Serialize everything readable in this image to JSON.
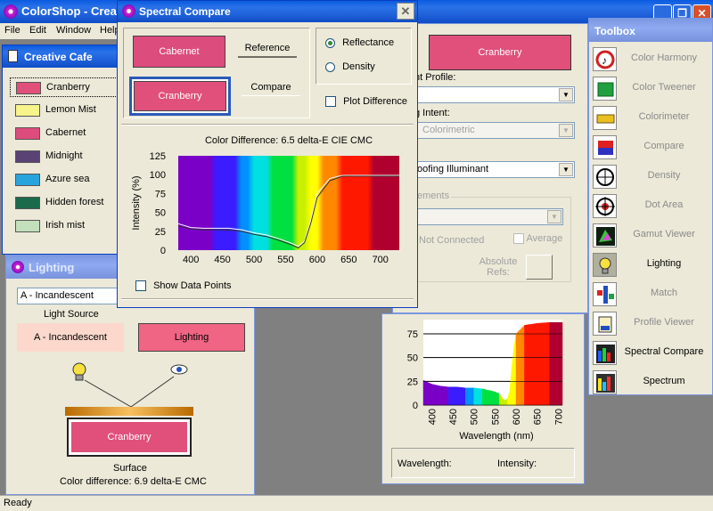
{
  "app": {
    "title": "ColorShop - Creat",
    "status": "Ready"
  },
  "menu": [
    "File",
    "Edit",
    "Window",
    "Help"
  ],
  "creative_cafe": {
    "title": "Creative Cafe",
    "swatches": [
      {
        "name": "Cranberry",
        "color": "#e0507a"
      },
      {
        "name": "Lemon Mist",
        "color": "#f6f48a"
      },
      {
        "name": "Cabernet",
        "color": "#dc4c7c"
      },
      {
        "name": "Midnight",
        "color": "#5a4274"
      },
      {
        "name": "Azure sea",
        "color": "#27a4dc"
      },
      {
        "name": "Hidden forest",
        "color": "#1c6a4c"
      },
      {
        "name": "Irish mist",
        "color": "#c2e0bc"
      }
    ]
  },
  "lighting": {
    "title": "Lighting",
    "source_select": "A - Incandescent",
    "light_source_label": "Light Source",
    "source_button": "A - Incandescent",
    "lighting_button": "Lighting",
    "surface_button": "Cranberry",
    "surface_label": "Surface",
    "color_difference": "Color difference: 6.9 delta-E CMC"
  },
  "spectral_compare": {
    "title": "Spectral Compare",
    "reference_swatch": "Cabernet",
    "reference_label": "Reference",
    "compare_swatch": "Cranberry",
    "compare_label": "Compare",
    "mode_reflectance": "Reflectance",
    "mode_density": "Density",
    "plot_difference": "Plot Difference",
    "show_data_points": "Show Data Points",
    "colors": {
      "reference": "#dc4c7c",
      "compare": "#e0507a"
    }
  },
  "profile_panel": {
    "swatch": "Cranberry",
    "label_profile": "nt Profile:",
    "label_intent": "g Intent:",
    "intent_value": "Colorimetric",
    "label_illuminant": ":",
    "illuminant_value": "oofing Illuminant",
    "measurements_label": "ements",
    "not_connected": "Not Connected",
    "average": "Average",
    "absolute_refs": "Absolute Refs:"
  },
  "spectrum_panel": {
    "readout_wavelength": "Wavelength:",
    "readout_intensity": "Intensity:"
  },
  "toolbox": {
    "title": "Toolbox",
    "items": [
      {
        "label": "Color Harmony",
        "icon": "color-harmony-icon"
      },
      {
        "label": "Color Tweener",
        "icon": "color-tweener-icon"
      },
      {
        "label": "Colorimeter",
        "icon": "colorimeter-icon"
      },
      {
        "label": "Compare",
        "icon": "compare-icon"
      },
      {
        "label": "Density",
        "icon": "density-icon"
      },
      {
        "label": "Dot Area",
        "icon": "dot-area-icon"
      },
      {
        "label": "Gamut Viewer",
        "icon": "gamut-viewer-icon"
      },
      {
        "label": "Lighting",
        "icon": "lighting-icon",
        "active": true
      },
      {
        "label": "Match",
        "icon": "match-icon"
      },
      {
        "label": "Profile Viewer",
        "icon": "profile-viewer-icon"
      },
      {
        "label": "Spectral Compare",
        "icon": "spectral-compare-icon",
        "active": true
      },
      {
        "label": "Spectrum",
        "icon": "spectrum-icon",
        "active": true
      }
    ]
  },
  "chart_data": [
    {
      "type": "line",
      "title": "Color Difference: 6.5 delta-E CIE CMC",
      "xlabel": "Wavelength (nm)",
      "ylabel": "Intensity (%)",
      "xlim": [
        380,
        730
      ],
      "ylim": [
        0,
        125
      ],
      "x_ticks": [
        400,
        450,
        500,
        550,
        600,
        650,
        700
      ],
      "y_ticks": [
        0,
        25,
        50,
        75,
        100,
        125
      ],
      "series": [
        {
          "values_x": [
            380,
            400,
            420,
            440,
            460,
            480,
            500,
            520,
            540,
            560,
            570,
            580,
            590,
            600,
            620,
            640,
            660,
            680,
            700,
            730
          ],
          "values_y": [
            35,
            30,
            29,
            29,
            29,
            27,
            23,
            20,
            15,
            9,
            5,
            12,
            40,
            75,
            95,
            99,
            99,
            99,
            99,
            99
          ]
        },
        {
          "values_x": [
            380,
            400,
            420,
            440,
            460,
            480,
            500,
            520,
            540,
            560,
            570,
            580,
            590,
            600,
            620,
            640,
            660,
            680,
            700,
            730
          ],
          "values_y": [
            32,
            28,
            27,
            27,
            27,
            25,
            21,
            18,
            13,
            7,
            3,
            10,
            36,
            70,
            92,
            98,
            98,
            98,
            98,
            98
          ]
        }
      ]
    },
    {
      "type": "area",
      "xlabel": "Wavelength (nm)",
      "ylabel": "",
      "xlim": [
        380,
        710
      ],
      "ylim": [
        0,
        90
      ],
      "x_ticks": [
        400,
        450,
        500,
        550,
        600,
        650,
        700
      ],
      "y_ticks": [
        0,
        25,
        50,
        75
      ],
      "x": [
        380,
        400,
        420,
        440,
        460,
        480,
        500,
        520,
        540,
        550,
        560,
        570,
        575,
        580,
        585,
        590,
        595,
        600,
        620,
        650,
        680,
        700,
        710
      ],
      "values": [
        26,
        22,
        20,
        19,
        19,
        18,
        18,
        17,
        15,
        14,
        12,
        6,
        5,
        7,
        15,
        40,
        60,
        75,
        84,
        86,
        87,
        87,
        87
      ]
    }
  ]
}
